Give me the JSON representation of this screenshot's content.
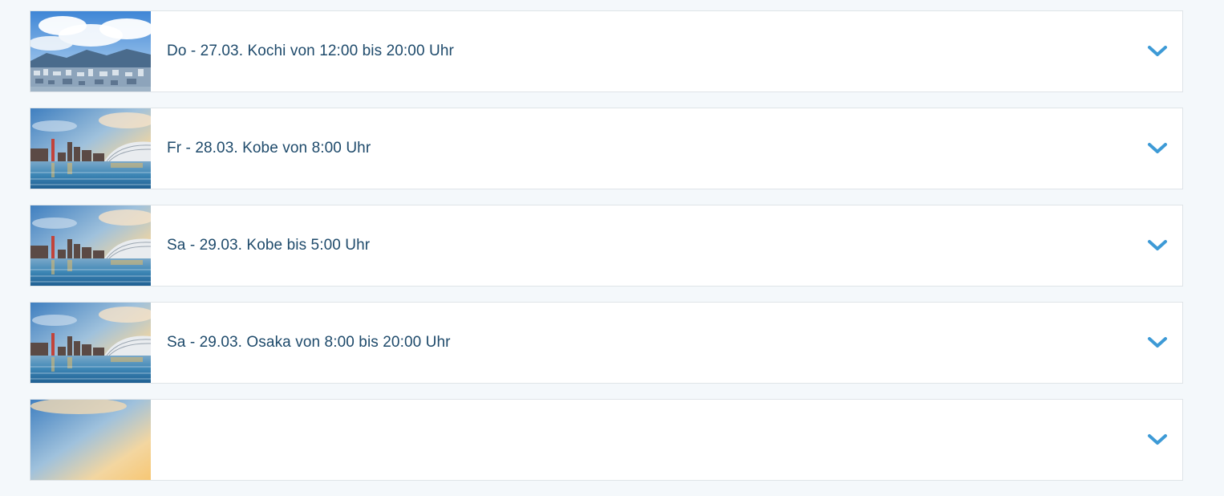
{
  "itinerary": [
    {
      "label": "Do - 27.03. Kochi von 12:00 bis 20:00 Uhr",
      "image": "kochi-city-panorama",
      "expand_icon": "chevron-down-icon"
    },
    {
      "label": "Fr - 28.03. Kobe von 8:00 Uhr",
      "image": "kobe-harbor-skyline",
      "expand_icon": "chevron-down-icon"
    },
    {
      "label": "Sa - 29.03. Kobe bis 5:00 Uhr",
      "image": "kobe-harbor-skyline",
      "expand_icon": "chevron-down-icon"
    },
    {
      "label": "Sa - 29.03. Osaka von 8:00 bis 20:00 Uhr",
      "image": "kobe-harbor-skyline",
      "expand_icon": "chevron-down-icon"
    },
    {
      "label": "",
      "image": "harbor-sky",
      "expand_icon": "chevron-down-icon"
    }
  ],
  "colors": {
    "label_text": "#1e4a6b",
    "chevron": "#3d9ad6",
    "card_border": "#dfe4e8",
    "page_background": "#f4f8fb"
  }
}
